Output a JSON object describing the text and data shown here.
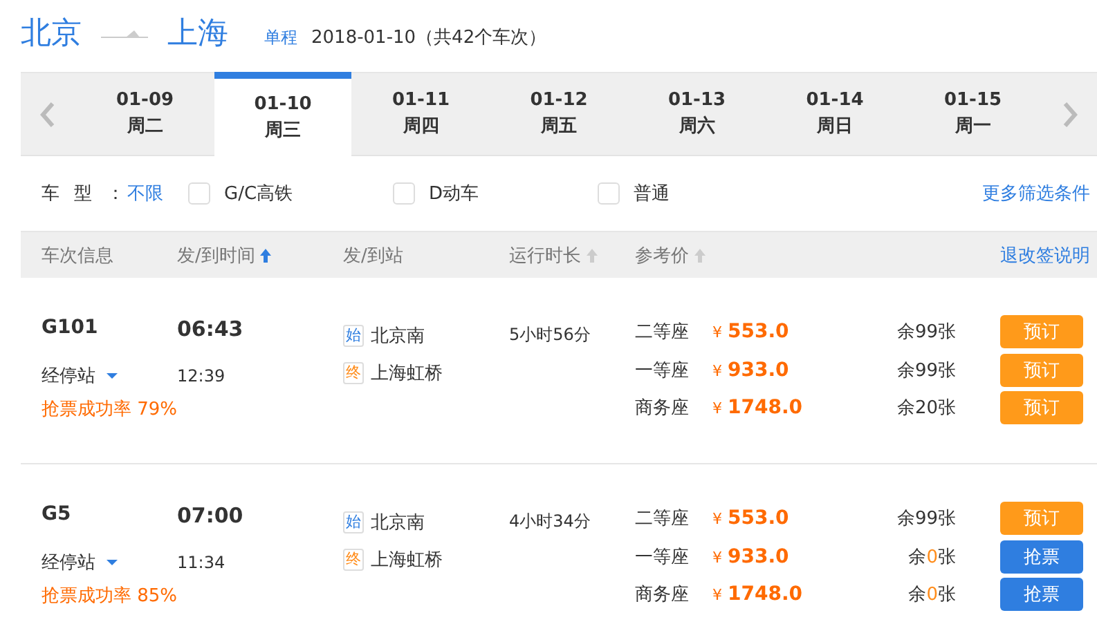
{
  "route": {
    "from": "北京",
    "to": "上海",
    "trip_type": "单程",
    "summary": "2018-01-10（共42个车次）"
  },
  "dates": [
    {
      "date": "01-09",
      "weekday": "周二",
      "selected": false
    },
    {
      "date": "01-10",
      "weekday": "周三",
      "selected": true
    },
    {
      "date": "01-11",
      "weekday": "周四",
      "selected": false
    },
    {
      "date": "01-12",
      "weekday": "周五",
      "selected": false
    },
    {
      "date": "01-13",
      "weekday": "周六",
      "selected": false
    },
    {
      "date": "01-14",
      "weekday": "周日",
      "selected": false
    },
    {
      "date": "01-15",
      "weekday": "周一",
      "selected": false
    }
  ],
  "filter": {
    "label": "车型：",
    "value": "不限",
    "options": [
      {
        "label": "G/C高铁",
        "checked": false
      },
      {
        "label": "D动车",
        "checked": false
      },
      {
        "label": "普通",
        "checked": false
      }
    ],
    "more_link": "更多筛选条件"
  },
  "table": {
    "columns": [
      {
        "label": "车次信息"
      },
      {
        "label": "发/到时间",
        "sortable": true,
        "sorted": true
      },
      {
        "label": "发/到站"
      },
      {
        "label": "运行时长",
        "sortable": true,
        "sorted": false
      },
      {
        "label": "参考价",
        "sortable": true,
        "sorted": false
      }
    ],
    "policy_link": "退改签说明",
    "rows": [
      {
        "train": "G101",
        "stops_link": "经停站",
        "success_rate": "抢票成功率 79%",
        "depart_time": "06:43",
        "arrive_time": "12:39",
        "stations": [
          {
            "kind": "start",
            "badge": "始",
            "name": "北京南"
          },
          {
            "kind": "end",
            "badge": "终",
            "name": "上海虹桥"
          }
        ],
        "duration": "5小时56分",
        "seats": [
          {
            "class": "二等座",
            "currency": "¥",
            "price": "553.0",
            "remaining": {
              "prefix": "余",
              "count": "99",
              "suffix": "张",
              "sold_out": false
            },
            "button": {
              "kind": "book",
              "label": "预订"
            }
          },
          {
            "class": "一等座",
            "currency": "¥",
            "price": "933.0",
            "remaining": {
              "prefix": "余",
              "count": "99",
              "suffix": "张",
              "sold_out": false
            },
            "button": {
              "kind": "book",
              "label": "预订"
            }
          },
          {
            "class": "商务座",
            "currency": "¥",
            "price": "1748.0",
            "remaining": {
              "prefix": "余",
              "count": "20",
              "suffix": "张",
              "sold_out": false
            },
            "button": {
              "kind": "book",
              "label": "预订"
            }
          }
        ]
      },
      {
        "train": "G5",
        "stops_link": "经停站",
        "success_rate": "抢票成功率 85%",
        "depart_time": "07:00",
        "arrive_time": "11:34",
        "stations": [
          {
            "kind": "start",
            "badge": "始",
            "name": "北京南"
          },
          {
            "kind": "end",
            "badge": "终",
            "name": "上海虹桥"
          }
        ],
        "duration": "4小时34分",
        "seats": [
          {
            "class": "二等座",
            "currency": "¥",
            "price": "553.0",
            "remaining": {
              "prefix": "余",
              "count": "99",
              "suffix": "张",
              "sold_out": false
            },
            "button": {
              "kind": "book",
              "label": "预订"
            }
          },
          {
            "class": "一等座",
            "currency": "¥",
            "price": "933.0",
            "remaining": {
              "prefix": "余",
              "count": "0",
              "suffix": "张",
              "sold_out": true
            },
            "button": {
              "kind": "grab",
              "label": "抢票"
            }
          },
          {
            "class": "商务座",
            "currency": "¥",
            "price": "1748.0",
            "remaining": {
              "prefix": "余",
              "count": "0",
              "suffix": "张",
              "sold_out": true
            },
            "button": {
              "kind": "grab",
              "label": "抢票"
            }
          }
        ]
      }
    ]
  }
}
